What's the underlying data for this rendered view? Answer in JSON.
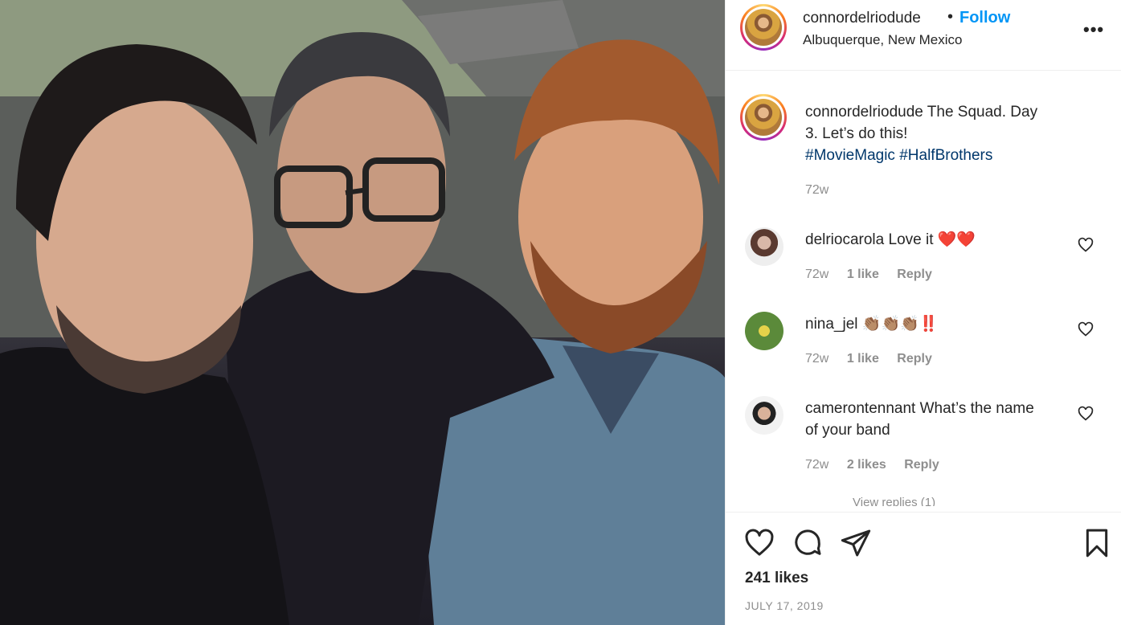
{
  "header": {
    "username": "connordelriodude",
    "separator": "•",
    "follow_label": "Follow",
    "location": "Albuquerque, New Mexico",
    "more_label": "•••"
  },
  "caption": {
    "username": "connordelriodude",
    "text": "The Squad. Day 3. Let’s do this!",
    "hashtags": [
      "#MovieMagic",
      "#HalfBrothers"
    ],
    "time": "72w"
  },
  "comments": [
    {
      "username": "delriocarola",
      "text": "Love it ❤️❤️",
      "time": "72w",
      "likes": "1 like",
      "reply": "Reply"
    },
    {
      "username": "nina_jel",
      "text": "👏🏽👏🏽👏🏽‼️",
      "time": "72w",
      "likes": "1 like",
      "reply": "Reply"
    },
    {
      "username": "camerontennant",
      "text": "What’s the name of your band",
      "time": "72w",
      "likes": "2 likes",
      "reply": "Reply"
    }
  ],
  "view_replies": "View replies (1)",
  "footer": {
    "likes": "241 likes",
    "date": "JULY 17, 2019"
  },
  "colors": {
    "link": "#0095f6",
    "hashtag": "#00376b",
    "muted": "#8e8e8e",
    "heart_red": "#ed4956"
  }
}
